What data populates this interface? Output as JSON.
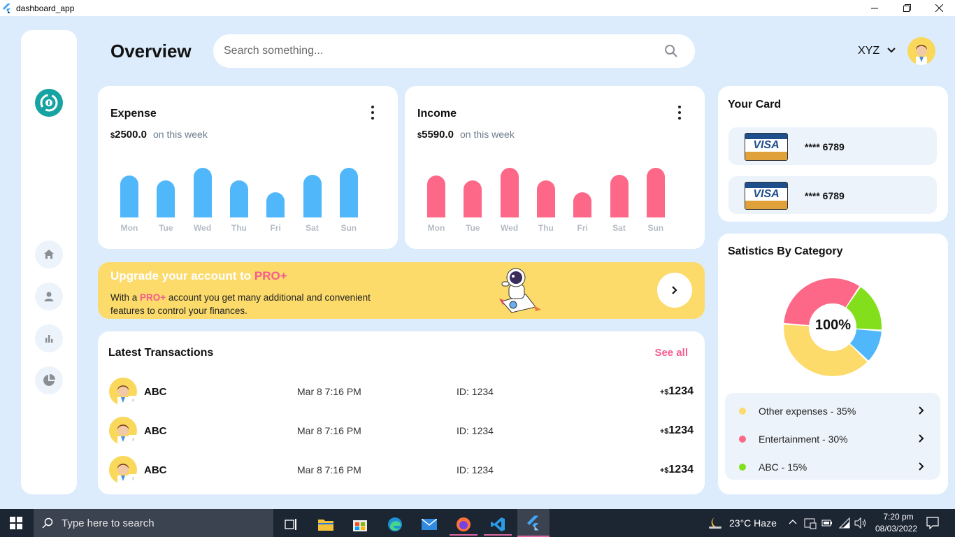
{
  "window": {
    "title": "dashboard_app"
  },
  "header": {
    "title": "Overview",
    "search_placeholder": "Search something...",
    "user_name": "XYZ"
  },
  "expense": {
    "title": "Expense",
    "currency": "$",
    "amount": "2500.0",
    "period": "on this week",
    "color": "#4fb7fa",
    "chart_data": {
      "type": "bar",
      "categories": [
        "Mon",
        "Tue",
        "Wed",
        "Thu",
        "Fri",
        "Sat",
        "Sun"
      ],
      "values": [
        60,
        53,
        71,
        53,
        36,
        61,
        71
      ]
    }
  },
  "income": {
    "title": "Income",
    "currency": "$",
    "amount": "5590.0",
    "period": "on this week",
    "color": "#fd6888",
    "chart_data": {
      "type": "bar",
      "categories": [
        "Mon",
        "Tue",
        "Wed",
        "Thu",
        "Fri",
        "Sat",
        "Sun"
      ],
      "values": [
        60,
        53,
        71,
        53,
        36,
        61,
        71
      ]
    }
  },
  "promo": {
    "title_prefix": "Upgrade your account to ",
    "title_pro": "PRO+",
    "text_prefix": "With a ",
    "text_pro": "PRO+",
    "text_suffix": " account you get many additional and convenient features to control your finances."
  },
  "transactions": {
    "title": "Latest Transactions",
    "see_all": "See all",
    "rows": [
      {
        "name": "ABC",
        "date": "Mar 8 7:16 PM",
        "id": "ID: 1234",
        "sign": "+$",
        "amount": "1234"
      },
      {
        "name": "ABC",
        "date": "Mar 8 7:16 PM",
        "id": "ID: 1234",
        "sign": "+$",
        "amount": "1234"
      },
      {
        "name": "ABC",
        "date": "Mar 8 7:16 PM",
        "id": "ID: 1234",
        "sign": "+$",
        "amount": "1234"
      }
    ]
  },
  "your_card": {
    "title": "Your Card",
    "cards": [
      {
        "brand": "VISA",
        "number": "**** 6789"
      },
      {
        "brand": "VISA",
        "number": "**** 6789"
      }
    ]
  },
  "statistics": {
    "title": "Satistics By Category",
    "center_label": "100%",
    "chart_data": {
      "type": "pie",
      "slices": [
        {
          "label": "Other expenses",
          "value": 35,
          "color": "#fcdb6b"
        },
        {
          "label": "Entertainment",
          "value": 30,
          "color": "#fd6888"
        },
        {
          "label": "ABC",
          "value": 15,
          "color": "#83df1c"
        },
        {
          "label": "",
          "value": 10,
          "color": "#4fb7fa"
        }
      ]
    },
    "legend": [
      {
        "label": "Other expenses - 35%",
        "color": "#fcdb6b"
      },
      {
        "label": "Entertainment - 30%",
        "color": "#fd6888"
      },
      {
        "label": "ABC - 15%",
        "color": "#83df1c"
      }
    ]
  },
  "taskbar": {
    "search_placeholder": "Type here to search",
    "weather": "23°C  Haze",
    "time": "7:20 pm",
    "date": "08/03/2022"
  }
}
